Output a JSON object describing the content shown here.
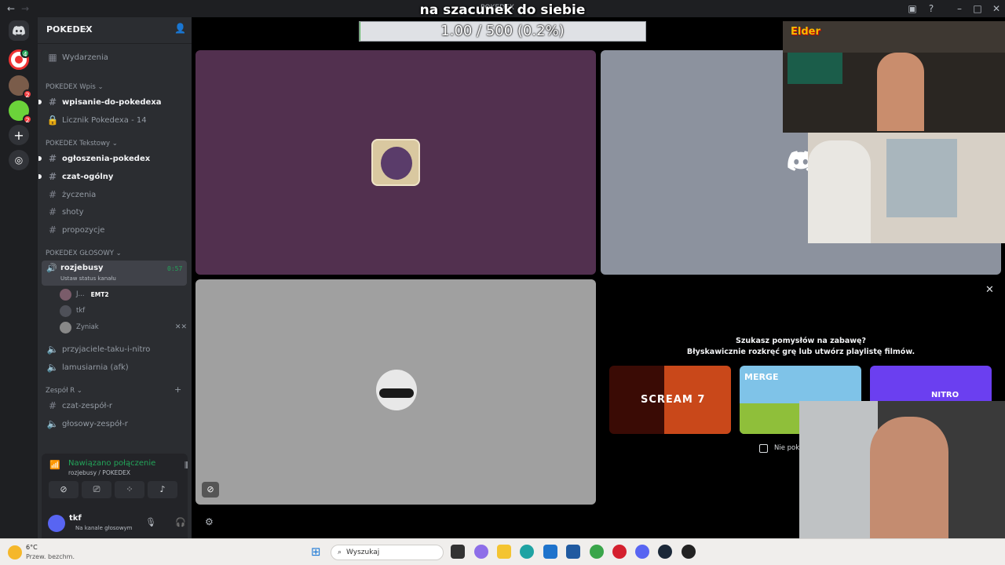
{
  "overlay": {
    "title": "na szacunek do siebie",
    "progress_text": "1.00 / 500 (0.2%)",
    "progress_percent": 0.2,
    "elder_label": "Elder"
  },
  "window": {
    "app_title": "POKEDEX"
  },
  "guild": {
    "name": "POKEDEX"
  },
  "sidebar": {
    "events": "Wydarzenia",
    "categories": [
      {
        "label": "POKEDEX Wpis"
      },
      {
        "label": "POKEDEX Tekstowy"
      },
      {
        "label": "POKEDEX GŁOSOWY"
      },
      {
        "label": "Zespół R"
      }
    ],
    "channels": [
      {
        "label": "wpisanie-do-pokedexa"
      },
      {
        "label": "Licznik Pokedexa - 14"
      },
      {
        "label": "ogłoszenia-pokedex"
      },
      {
        "label": "czat-ogólny"
      },
      {
        "label": "życzenia"
      },
      {
        "label": "shoty"
      },
      {
        "label": "propozycje"
      },
      {
        "label": "rozjebusy"
      },
      {
        "label": "przyjaciele-taku-i-nitro"
      },
      {
        "label": "lamusiarnia (afk)"
      },
      {
        "label": "czat-zespół-r"
      },
      {
        "label": "głosowy-zespół-r"
      }
    ],
    "voice_status_hint": "Ustaw status kanału",
    "voice_timer": "0:57",
    "voice_users": [
      {
        "name": "J...",
        "tag": "EMT2"
      },
      {
        "name": "tkf"
      },
      {
        "name": "Zyniak"
      }
    ]
  },
  "voice_panel": {
    "status": "Nawiązano połączenie",
    "location": "rozjebusy / POKEDEX"
  },
  "user_panel": {
    "name": "tkf",
    "status": "Na kanale głosowym"
  },
  "activity": {
    "heading": "Szukasz pomysłów na zabawę?",
    "subheading": "Błyskawicznie rozkręć grę lub utwórz playlistę filmów.",
    "cards": [
      {
        "title": "SCREAM 7"
      },
      {
        "title": "MERGE"
      },
      {
        "title": "NITRO"
      }
    ],
    "dont_show": "Nie pok..."
  },
  "taskbar": {
    "weather_temp": "6°C",
    "weather_desc": "Przew. bezchm.",
    "search_placeholder": "Wyszukaj"
  },
  "colors": {
    "accent": "#5865f2",
    "green": "#23a55a",
    "tile_purple": "#52304f",
    "tile_gray": "#8c929e"
  }
}
